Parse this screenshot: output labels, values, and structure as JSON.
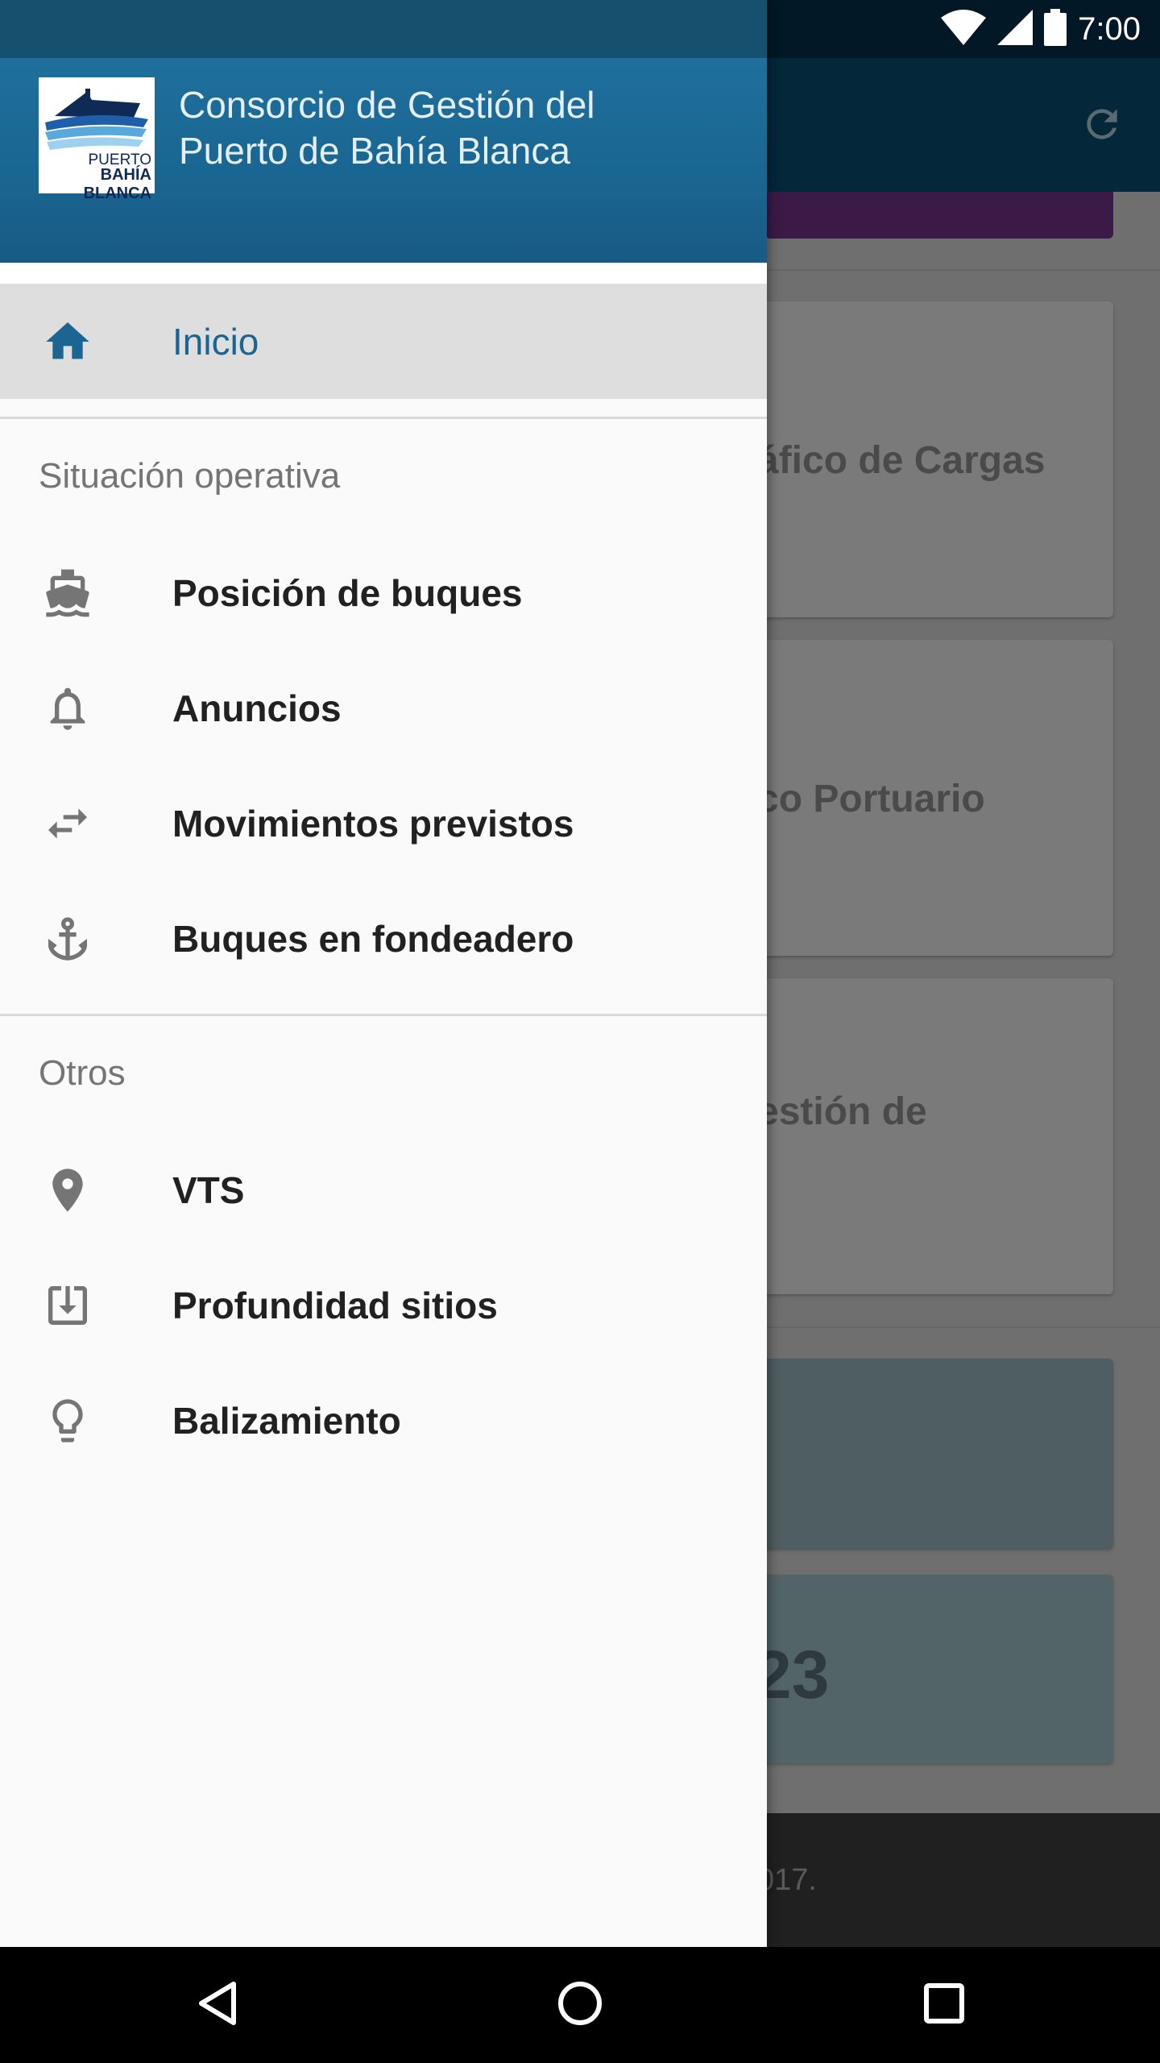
{
  "status_bar": {
    "time": "7:00"
  },
  "drawer": {
    "header": {
      "title_line1": "Consorcio de Gestión del",
      "title_line2": "Puerto de Bahía Blanca",
      "logo_small": "PUERTO",
      "logo_big": "BAHÍA BLANCA"
    },
    "home": {
      "label": "Inicio",
      "icon": "home-icon"
    },
    "sections": [
      {
        "title": "Situación operativa",
        "items": [
          {
            "label": "Posición de buques",
            "icon": "ship-icon"
          },
          {
            "label": "Anuncios",
            "icon": "bell-icon"
          },
          {
            "label": "Movimientos previstos",
            "icon": "swap-arrows-icon"
          },
          {
            "label": "Buques en fondeadero",
            "icon": "anchor-icon"
          }
        ]
      },
      {
        "title": "Otros",
        "items": [
          {
            "label": "VTS",
            "icon": "location-pin-icon"
          },
          {
            "label": "Profundidad sitios",
            "icon": "download-box-icon"
          },
          {
            "label": "Balizamiento",
            "icon": "lightbulb-icon"
          }
        ]
      }
    ]
  },
  "background": {
    "cards": [
      {
        "text": "áfico de Cargas"
      },
      {
        "text": "co Portuario"
      },
      {
        "text": "estión de"
      }
    ],
    "stat_number": "23",
    "footer_text": "017."
  },
  "colors": {
    "header_blue": "#1a6591",
    "active_text": "#1a6591",
    "drawer_bg": "#fafafa"
  }
}
